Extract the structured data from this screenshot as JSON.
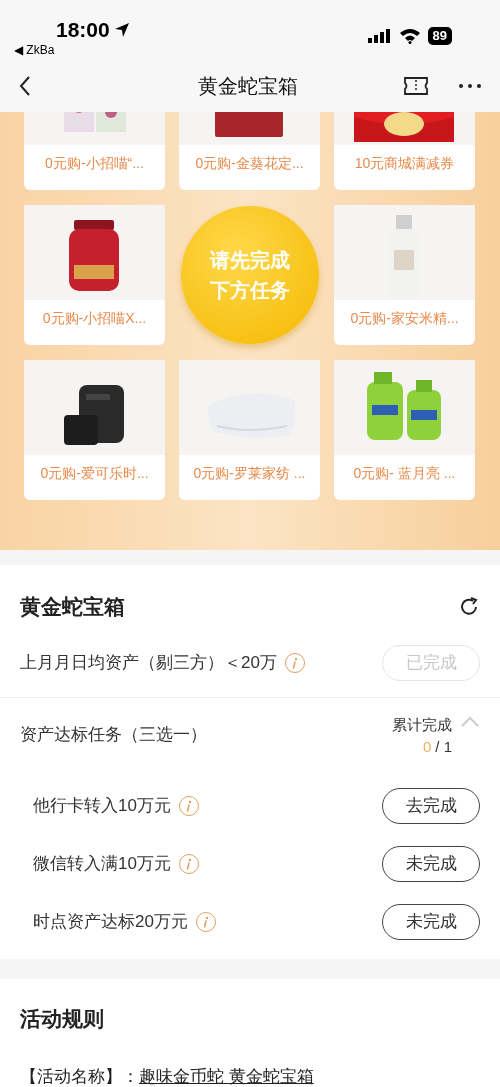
{
  "status_bar": {
    "time": "18:00",
    "back_app": "◀ ZkBa",
    "battery": "89"
  },
  "nav": {
    "title": "黄金蛇宝箱"
  },
  "products": [
    {
      "kind": "product",
      "name": "0元购-小招喵“..."
    },
    {
      "kind": "product",
      "name": "0元购-金葵花定..."
    },
    {
      "kind": "product",
      "name": "10元商城满减券"
    },
    {
      "kind": "product",
      "name": "0元购-小招喵X..."
    },
    {
      "kind": "product",
      "name": "0元购-家安米精..."
    },
    {
      "kind": "product",
      "name": "0元购-爱可乐时..."
    },
    {
      "kind": "product",
      "name": "0元购-罗莱家纺 ..."
    },
    {
      "kind": "product",
      "name": "0元购- 蓝月亮 ..."
    }
  ],
  "unlock_button": {
    "label": "请先完成下方任务"
  },
  "tasks": {
    "title": "黄金蛇宝箱",
    "main": {
      "label": "上月月日均资产（剔三方）＜20万",
      "button": "已完成",
      "done": true
    },
    "group": {
      "label": "资产达标任务（三选一）",
      "progress_label": "累计完成",
      "progress_done": "0",
      "progress_total": "/ 1",
      "expanded": true,
      "items": [
        {
          "label": "他行卡转入10万元",
          "button": "去完成",
          "done": false
        },
        {
          "label": "微信转入满10万元",
          "button": "未完成",
          "done": false
        },
        {
          "label": "时点资产达标20万元",
          "button": "未完成",
          "done": false
        }
      ]
    }
  },
  "rules": {
    "title": "活动规则",
    "name_label": "【活动名称】：",
    "name_value": "趣味金币蛇 黄金蛇宝箱"
  }
}
